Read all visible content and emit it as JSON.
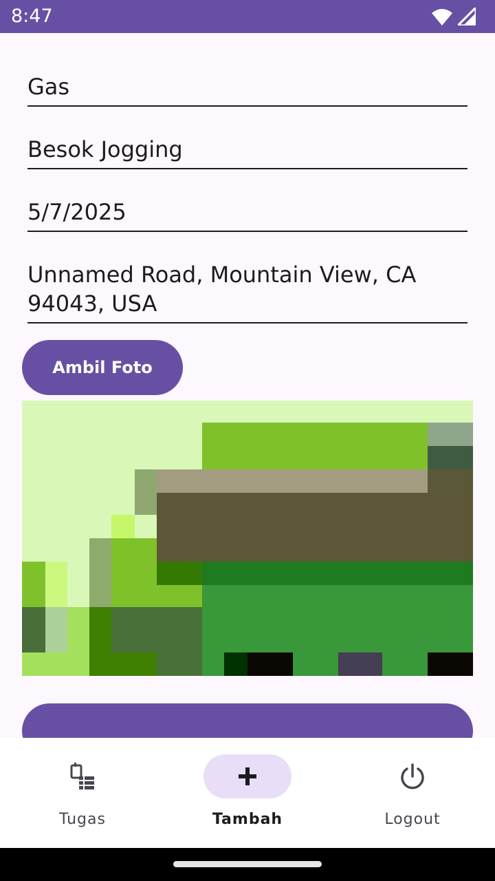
{
  "status_bar": {
    "time": "8:47",
    "icons": [
      "wifi-icon",
      "signal-icon"
    ],
    "background": "#6750a4"
  },
  "form": {
    "title_value": "Gas",
    "description_value": "Besok Jogging",
    "date_value": "5/7/2025",
    "location_value": "Unnamed Road, Mountain View, CA 94043, USA"
  },
  "buttons": {
    "take_photo": "Ambil Foto",
    "accent": "#6750a4"
  },
  "bottom_nav": {
    "items": [
      {
        "label": "Tugas",
        "icon": "task-list-icon",
        "active": false
      },
      {
        "label": "Tambah",
        "icon": "plus-icon",
        "active": true
      },
      {
        "label": "Logout",
        "icon": "power-icon",
        "active": false
      }
    ]
  }
}
